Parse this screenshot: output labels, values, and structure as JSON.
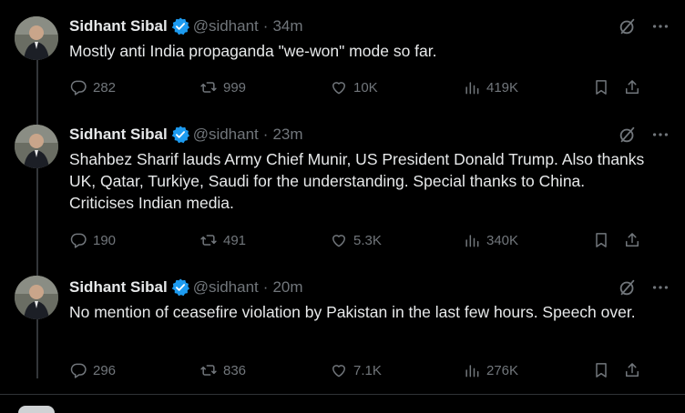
{
  "tweets": [
    {
      "name": "Sidhant Sibal",
      "handle": "@sidhant",
      "time": "34m",
      "text": "Mostly anti India propaganda \"we-won\" mode so far.",
      "replies": "282",
      "reposts": "999",
      "likes": "10K",
      "views": "419K"
    },
    {
      "name": "Sidhant Sibal",
      "handle": "@sidhant",
      "time": "23m",
      "text": "Shahbez Sharif lauds Army Chief Munir, US President Donald Trump. Also thanks UK, Qatar, Turkiye, Saudi for the understanding. Special thanks to China. Criticises Indian media.",
      "replies": "190",
      "reposts": "491",
      "likes": "5.3K",
      "views": "340K"
    },
    {
      "name": "Sidhant Sibal",
      "handle": "@sidhant",
      "time": "20m",
      "text": "No mention of ceasefire violation by Pakistan in the last few hours. Speech over.",
      "replies": "296",
      "reposts": "836",
      "likes": "7.1K",
      "views": "276K"
    }
  ],
  "separator": "·",
  "icons": {
    "verified": "verified-badge-icon",
    "grok": "grok-icon",
    "more": "more-icon",
    "reply": "reply-icon",
    "repost": "repost-icon",
    "like": "like-icon",
    "views": "views-icon",
    "bookmark": "bookmark-icon",
    "share": "share-icon"
  },
  "colors": {
    "background": "#000000",
    "text": "#e7e9ea",
    "muted": "#71767b",
    "verified": "#1d9bf0"
  }
}
